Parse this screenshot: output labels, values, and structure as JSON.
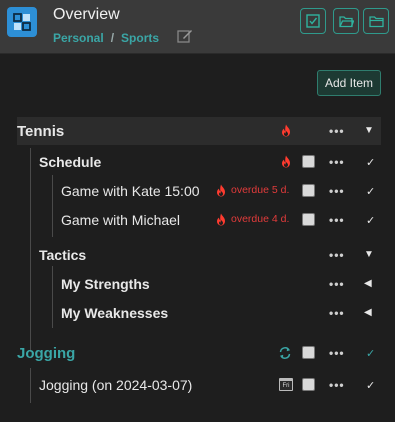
{
  "header": {
    "title": "Overview",
    "breadcrumb": [
      "Personal",
      "Sports"
    ],
    "separator": "/"
  },
  "toolbar": {
    "add_item_label": "Add Item"
  },
  "colors": {
    "accent": "#3aa6a6",
    "overdue": "#e23b3b",
    "app_icon": "#2d8fd6",
    "bar": "#2c2c2c"
  },
  "icons": [
    "app-logo-icon",
    "edit-pencil-icon",
    "checklist-icon",
    "folder-open-icon",
    "folder-icon",
    "flame-icon",
    "repeat-icon",
    "calendar-icon"
  ],
  "tree": {
    "tennis": {
      "label": "Tennis"
    },
    "schedule": {
      "label": "Schedule"
    },
    "game_kate": {
      "label": "Game with Kate 15:00",
      "overdue": "overdue 5 d."
    },
    "game_michael": {
      "label": "Game with Michael",
      "overdue": "overdue 4 d."
    },
    "tactics": {
      "label": "Tactics"
    },
    "strengths": {
      "label": "My Strengths"
    },
    "weaknesses": {
      "label": "My Weaknesses"
    },
    "jogging": {
      "label": "Jogging"
    },
    "jogging_item": {
      "label": "Jogging (on 2024-03-07)",
      "calendar_day": "Fri"
    }
  },
  "menu_glyph": "•••",
  "tick_glyph": "✓",
  "caret_down": "▼",
  "caret_left": "◀"
}
